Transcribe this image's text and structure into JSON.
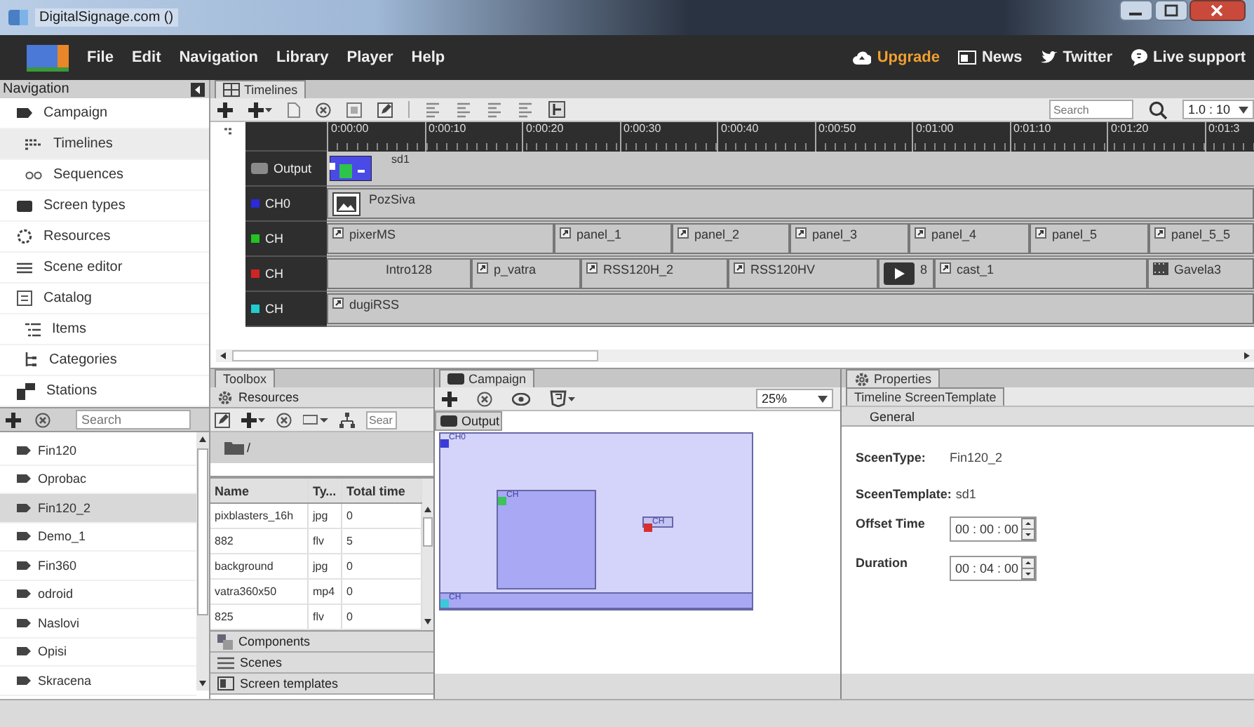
{
  "window": {
    "title": "DigitalSignage.com ()"
  },
  "menu": [
    "File",
    "Edit",
    "Navigation",
    "Library",
    "Player",
    "Help"
  ],
  "top_links": [
    {
      "label": "Upgrade",
      "kind": "upgrade"
    },
    {
      "label": "News",
      "kind": "news"
    },
    {
      "label": "Twitter",
      "kind": "twitter"
    },
    {
      "label": "Live support",
      "kind": "support"
    }
  ],
  "navigation": {
    "title": "Navigation",
    "items": [
      {
        "label": "Campaign",
        "kind": "campaign",
        "selected": false,
        "children": [
          {
            "label": "Timelines",
            "kind": "timelines",
            "selected": true
          },
          {
            "label": "Sequences",
            "kind": "sequences",
            "selected": false
          }
        ]
      },
      {
        "label": "Screen types",
        "kind": "screens",
        "selected": false
      },
      {
        "label": "Resources",
        "kind": "resources",
        "selected": false
      },
      {
        "label": "Scene editor",
        "kind": "scenes",
        "selected": false
      },
      {
        "label": "Catalog",
        "kind": "catalog",
        "selected": false,
        "children": [
          {
            "label": "Items",
            "kind": "items",
            "selected": false
          },
          {
            "label": "Categories",
            "kind": "categories",
            "selected": false
          }
        ]
      },
      {
        "label": "Stations",
        "kind": "stations",
        "selected": false
      }
    ]
  },
  "stations": {
    "search_placeholder": "Search",
    "items": [
      {
        "label": "Fin120",
        "selected": false
      },
      {
        "label": "Oprobac",
        "selected": false
      },
      {
        "label": "Fin120_2",
        "selected": true
      },
      {
        "label": "Demo_1",
        "selected": false
      },
      {
        "label": "Fin360",
        "selected": false
      },
      {
        "label": "odroid",
        "selected": false
      },
      {
        "label": "Naslovi",
        "selected": false
      },
      {
        "label": "Opisi",
        "selected": false
      },
      {
        "label": "Skracena",
        "selected": false
      }
    ]
  },
  "timelines": {
    "tab": "Timelines",
    "search_placeholder": "Search",
    "zoom": "1.0 : 10",
    "ticks": [
      "0:00:00",
      "0:00:10",
      "0:00:20",
      "0:00:30",
      "0:00:40",
      "0:00:50",
      "0:01:00",
      "0:01:10",
      "0:01:20",
      "0:01:3"
    ],
    "output": {
      "label": "Output",
      "clip": "sd1"
    },
    "channels": [
      {
        "label": "CH0",
        "color": "#2a2ad8",
        "clips": [
          {
            "label": "PozSiva",
            "kind": "image"
          }
        ]
      },
      {
        "label": "CH",
        "color": "#22c422",
        "clips": [
          {
            "label": "pixerMS",
            "kind": "link"
          },
          {
            "label": "panel_1",
            "kind": "link"
          },
          {
            "label": "panel_2",
            "kind": "link"
          },
          {
            "label": "panel_3",
            "kind": "link"
          },
          {
            "label": "panel_4",
            "kind": "link"
          },
          {
            "label": "panel_5",
            "kind": "link"
          },
          {
            "label": "panel_5_5",
            "kind": "link"
          }
        ]
      },
      {
        "label": "CH",
        "color": "#d02424",
        "clips": [
          {
            "label": "Intro128",
            "kind": "plain"
          },
          {
            "label": "p_vatra",
            "kind": "link"
          },
          {
            "label": "RSS120H_2",
            "kind": "link"
          },
          {
            "label": "RSS120HV",
            "kind": "link"
          },
          {
            "label": "8",
            "kind": "video"
          },
          {
            "label": "cast_1",
            "kind": "link"
          },
          {
            "label": "Gavela3",
            "kind": "film"
          }
        ]
      },
      {
        "label": "CH",
        "color": "#22cccc",
        "clips": [
          {
            "label": "dugiRSS",
            "kind": "link"
          }
        ]
      }
    ]
  },
  "toolbox": {
    "tab": "Toolbox",
    "section": "Resources",
    "search_placeholder": "Sear",
    "path": "/",
    "columns": [
      "Name",
      "Ty...",
      "Total time"
    ],
    "rows": [
      [
        "pixblasters_16h",
        "jpg",
        "0"
      ],
      [
        "882",
        "flv",
        "5"
      ],
      [
        "background",
        "jpg",
        "0"
      ],
      [
        "vatra360x50",
        "mp4",
        "0"
      ],
      [
        "825",
        "flv",
        "0"
      ]
    ],
    "more_sections": [
      {
        "label": "Components",
        "kind": "components"
      },
      {
        "label": "Scenes",
        "kind": "scenes"
      },
      {
        "label": "Screen templates",
        "kind": "templates"
      }
    ]
  },
  "campaign": {
    "tab": "Campaign",
    "zoom": "25%",
    "view": "Output",
    "regions": [
      {
        "label": "CH0",
        "color": "#3b3bd6"
      },
      {
        "label": "CH",
        "color": "#3cc45a"
      },
      {
        "label": "CH",
        "color": "#d83030"
      },
      {
        "label": "CH",
        "color": "#3cc8d8"
      }
    ]
  },
  "properties": {
    "tab": "Properties",
    "subtab": "Timeline ScreenTemplate",
    "group": "General",
    "fields": [
      {
        "label": "SceenType:",
        "value": "Fin120_2",
        "kind": "text"
      },
      {
        "label": "SceenTemplate:",
        "value": "sd1",
        "kind": "inline"
      },
      {
        "label": "Offset Time",
        "value": "00 : 00 : 00",
        "kind": "time"
      },
      {
        "label": "Duration",
        "value": "00 : 04 : 00",
        "kind": "time"
      }
    ]
  }
}
